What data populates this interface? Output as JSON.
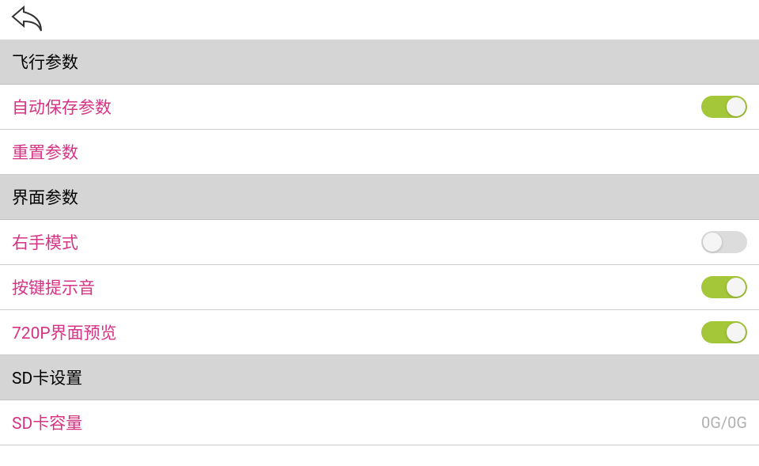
{
  "sections": {
    "flight": {
      "title": "飞行参数",
      "auto_save": {
        "label": "自动保存参数",
        "enabled": true
      },
      "reset": {
        "label": "重置参数"
      }
    },
    "interface": {
      "title": "界面参数",
      "right_hand_mode": {
        "label": "右手模式",
        "enabled": false
      },
      "key_sound": {
        "label": "按键提示音",
        "enabled": true
      },
      "preview_720p": {
        "label": "720P界面预览",
        "enabled": true
      }
    },
    "sd_card": {
      "title": "SD卡设置",
      "capacity": {
        "label": "SD卡容量",
        "value": "0G/0G"
      }
    }
  }
}
